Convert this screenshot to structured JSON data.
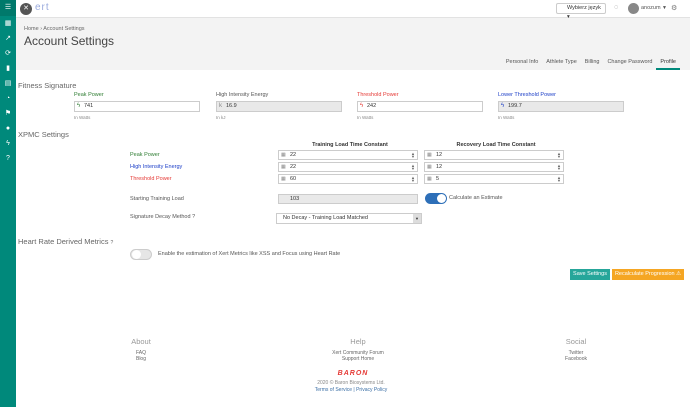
{
  "topbar": {
    "logo_text": "ert",
    "language_label": "Wybierz język",
    "username": "anozum"
  },
  "header": {
    "breadcrumb": "Home › Account Settings",
    "title": "Account Settings",
    "tabs": [
      "Personal Info",
      "Athlete Type",
      "Billing",
      "Change Password",
      "Profile"
    ],
    "active_tab": "Profile"
  },
  "fitness": {
    "title": "Fitness Signature",
    "fields": [
      {
        "label": "Peak Power",
        "value": "741",
        "unit": "In Watts",
        "color": "#2e7d32"
      },
      {
        "label": "High Intensity Energy",
        "value": "16.9",
        "unit": "In kJ",
        "color": "#555555"
      },
      {
        "label": "Threshold Power",
        "value": "242",
        "unit": "In Watts",
        "color": "#e53935"
      },
      {
        "label": "Lower Threshold Power",
        "value": "199.7",
        "unit": "In Watts",
        "color": "#1e40c8"
      }
    ]
  },
  "xpmc": {
    "title": "XPMC Settings",
    "col_training": "Training Load Time Constant",
    "col_recovery": "Recovery Load Time Constant",
    "rows": [
      {
        "label": "Peak Power",
        "color": "#2e7d32",
        "training": "22",
        "recovery": "12"
      },
      {
        "label": "High Intensity Energy",
        "color": "#1e40c8",
        "training": "22",
        "recovery": "12"
      },
      {
        "label": "Threshold Power",
        "color": "#e53935",
        "training": "60",
        "recovery": "5"
      }
    ],
    "starting_label": "Starting Training Load",
    "starting_value": "103",
    "estimate_label": "Calculate an Estimate",
    "decay_label": "Signature Decay Method",
    "decay_value": "No Decay - Training Load Matched"
  },
  "heart": {
    "title": "Heart Rate Derived Metrics",
    "toggle_label": "Enable the estimation of Xert Metrics like XSS and Focus using Heart Rate"
  },
  "actions": {
    "save": "Save Settings",
    "recalc": "Recalculate Progression"
  },
  "footer": {
    "about": {
      "title": "About",
      "links": [
        "FAQ",
        "Blog"
      ]
    },
    "help": {
      "title": "Help",
      "links": [
        "Xert Community Forum",
        "Support Home"
      ]
    },
    "social": {
      "title": "Social",
      "links": [
        "Twitter",
        "Facebook"
      ]
    },
    "brand": "BARON",
    "copyright": "2020 © Baron Biosystems Ltd.",
    "terms": "Terms of Service",
    "privacy": "Privacy Policy"
  },
  "colors": {
    "accent": "#00897b",
    "save": "#26a69a",
    "recalc": "#f5a623",
    "toggle_on": "#2d6fb8"
  }
}
